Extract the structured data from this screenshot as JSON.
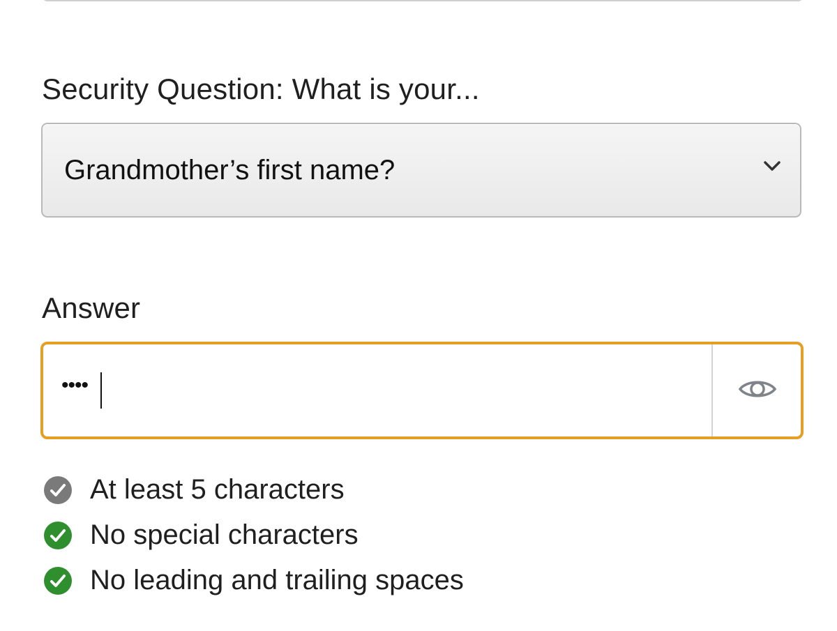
{
  "security_question": {
    "label": "Security Question: What is your...",
    "selected_value": "Grandmother’s first name?",
    "dropdown_icon": "chevron-down-icon"
  },
  "answer": {
    "label": "Answer",
    "masked_value": "••••",
    "toggle_icon": "eye-icon",
    "focus_color": "#e39f26"
  },
  "requirements": [
    {
      "text": "At least 5 characters",
      "status": "unmet",
      "icon": "check-circle-icon",
      "color": "#7a7a7a"
    },
    {
      "text": "No special characters",
      "status": "met",
      "icon": "check-circle-icon",
      "color": "#2f8f2f"
    },
    {
      "text": "No leading and trailing spaces",
      "status": "met",
      "icon": "check-circle-icon",
      "color": "#2f8f2f"
    }
  ]
}
